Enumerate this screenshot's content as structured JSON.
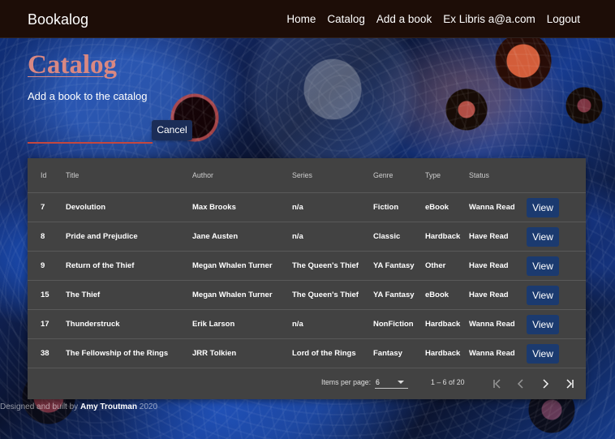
{
  "header": {
    "brand": "Bookalog",
    "nav": [
      "Home",
      "Catalog",
      "Add a book",
      "Ex Libris a@a.com",
      "Logout"
    ]
  },
  "page": {
    "title": "Catalog",
    "subtitle": "Add a book to the catalog"
  },
  "form": {
    "input_value": "",
    "cancel_label": "Cancel"
  },
  "table": {
    "headers": [
      "Id",
      "Title",
      "Author",
      "Series",
      "Genre",
      "Type",
      "Status"
    ],
    "rows": [
      {
        "id": "7",
        "title": "Devolution",
        "author": "Max Brooks",
        "series": "n/a",
        "genre": "Fiction",
        "type": "eBook",
        "status": "Wanna Read",
        "action": "View"
      },
      {
        "id": "8",
        "title": "Pride and Prejudice",
        "author": "Jane Austen",
        "series": "n/a",
        "genre": "Classic",
        "type": "Hardback",
        "status": "Have Read",
        "action": "View"
      },
      {
        "id": "9",
        "title": "Return of the Thief",
        "author": "Megan Whalen Turner",
        "series": "The Queen's Thief",
        "genre": "YA Fantasy",
        "type": "Other",
        "status": "Have Read",
        "action": "View"
      },
      {
        "id": "15",
        "title": "The Thief",
        "author": "Megan Whalen Turner",
        "series": "The Queen's Thief",
        "genre": "YA Fantasy",
        "type": "eBook",
        "status": "Have Read",
        "action": "View"
      },
      {
        "id": "17",
        "title": "Thunderstruck",
        "author": "Erik Larson",
        "series": "n/a",
        "genre": "NonFiction",
        "type": "Hardback",
        "status": "Wanna Read",
        "action": "View"
      },
      {
        "id": "38",
        "title": "The Fellowship of the Rings",
        "author": "JRR Tolkien",
        "series": "Lord of the Rings",
        "genre": "Fantasy",
        "type": "Hardback",
        "status": "Wanna Read",
        "action": "View"
      }
    ]
  },
  "paginator": {
    "items_label": "Items per page:",
    "items_value": "6",
    "range": "1 – 6 of 20"
  },
  "footer": {
    "prefix": "Designed and built by ",
    "author": "Amy Troutman",
    "year": " 2020"
  },
  "colors": {
    "header_bg": "#1d0d07",
    "title": "#d98882",
    "accent_red": "#c4473e",
    "button_blue": "#1b3a6f",
    "table_bg": "#424242"
  },
  "icons": {
    "first_page": "first-page-icon",
    "previous_page": "chevron-left-icon",
    "next_page": "chevron-right-icon",
    "last_page": "last-page-icon",
    "select": "chevron-down-icon"
  }
}
